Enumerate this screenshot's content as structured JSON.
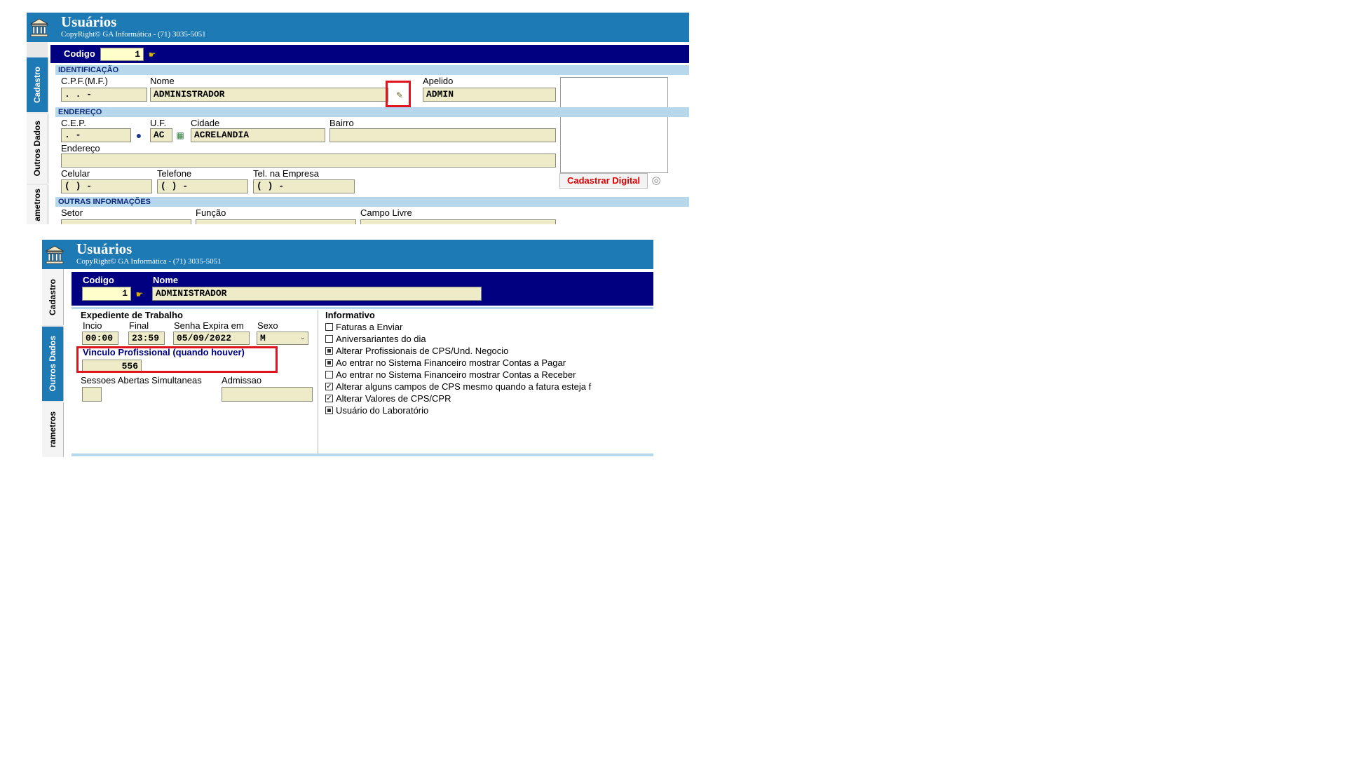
{
  "colors": {
    "header_blue": "#1e7ab5",
    "navy_bar": "#000080",
    "section_blue": "#b7d7ec",
    "field_bg": "#eeebc8",
    "highlight_red": "#e0141e"
  },
  "panel1": {
    "title": "Usuários",
    "copyright": "CopyRight© GA Informática - (71) 3035-5051",
    "tabs": [
      "Cadastro",
      "Outros Dados",
      "ametros"
    ],
    "codigo_label": "Codigo",
    "codigo_value": "1",
    "sections": {
      "identificacao": "IDENTIFICAÇÃO",
      "endereco": "ENDEREÇO",
      "outras": "OUTRAS INFORMAÇÕES"
    },
    "fields": {
      "cpf_label": "C.P.F.(M.F.)",
      "cpf_value": " .  .  -",
      "nome_label": "Nome",
      "nome_value": "ADMINISTRADOR",
      "apelido_label": "Apelido",
      "apelido_value": "ADMIN",
      "cep_label": "C.E.P.",
      "cep_value": " .  -",
      "uf_label": "U.F.",
      "uf_value": "AC",
      "cidade_label": "Cidade",
      "cidade_value": "ACRELANDIA",
      "bairro_label": "Bairro",
      "bairro_value": "",
      "endereco_label": "Endereço",
      "endereco_value": "",
      "celular_label": "Celular",
      "celular_value": "(  )    -",
      "telefone_label": "Telefone",
      "telefone_value": "(  )    -",
      "telempresa_label": "Tel. na Empresa",
      "telempresa_value": "(  )    -",
      "setor_label": "Setor",
      "funcao_label": "Função",
      "campolivre_label": "Campo Livre"
    },
    "cadastrar_digital": "Cadastrar Digital"
  },
  "panel2": {
    "title": "Usuários",
    "copyright": "CopyRight© GA Informática - (71) 3035-5051",
    "tabs": [
      "Cadastro",
      "Outros Dados",
      "rametros"
    ],
    "codigo_label": "Codigo",
    "codigo_value": "1",
    "nome_label": "Nome",
    "nome_value": "ADMINISTRADOR",
    "expediente_title": "Expediente de Trabalho",
    "inicio_label": "Incio",
    "inicio_value": "00:00",
    "final_label": "Final",
    "final_value": "23:59",
    "senha_label": "Senha Expira em",
    "senha_value": "05/09/2022",
    "sexo_label": "Sexo",
    "sexo_value": "M",
    "vinculo_label": "Vinculo Profissional (quando houver)",
    "vinculo_value": "556",
    "sessoes_label": "Sessoes Abertas Simultaneas",
    "admissao_label": "Admissao",
    "informativo_title": "Informativo",
    "checkboxes": [
      {
        "label": "Faturas a Enviar",
        "state": "unchecked"
      },
      {
        "label": "Aniversariantes do dia",
        "state": "unchecked"
      },
      {
        "label": "Alterar Profissionais de CPS/Und. Negocio",
        "state": "filled"
      },
      {
        "label": "Ao entrar no Sistema Financeiro mostrar Contas a Pagar",
        "state": "filled"
      },
      {
        "label": "Ao entrar no Sistema Financeiro mostrar Contas a Receber",
        "state": "unchecked"
      },
      {
        "label": "Alterar alguns campos de CPS mesmo quando a fatura esteja f",
        "state": "checked"
      },
      {
        "label": "Alterar Valores de CPS/CPR",
        "state": "checked"
      },
      {
        "label": "Usuário do Laboratório",
        "state": "filled"
      }
    ]
  }
}
